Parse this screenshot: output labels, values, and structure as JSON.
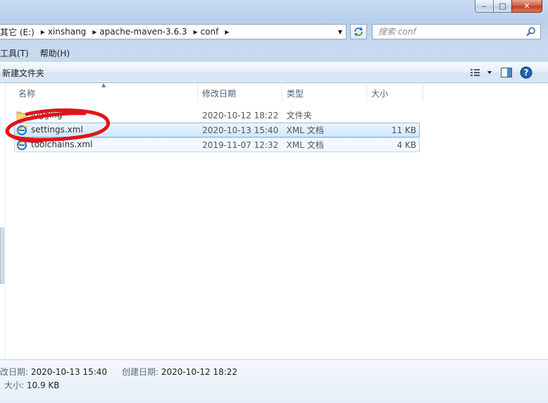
{
  "window": {
    "caption_buttons": {
      "minimize": "–",
      "maximize": "□",
      "close": "✕"
    }
  },
  "address": {
    "crumbs": [
      "其它 (E:)",
      "xinshang",
      "apache-maven-3.6.3",
      "conf"
    ],
    "dropdown_icon": "chevron-down-icon",
    "refresh_icon": "refresh-icon"
  },
  "search": {
    "placeholder": "搜索 conf",
    "icon": "search-icon"
  },
  "menubar": {
    "items": [
      "工具(T)",
      "帮助(H)"
    ]
  },
  "toolbar": {
    "new_folder_label": "新建文件夹",
    "icons": [
      "view-options-icon",
      "preview-pane-icon",
      "help-icon"
    ]
  },
  "columns": {
    "name": "名称",
    "modified": "修改日期",
    "type": "类型",
    "size": "大小"
  },
  "files": [
    {
      "name": "logging",
      "modified": "2020-10-12 18:22",
      "type": "文件夹",
      "size": "",
      "icon": "folder-icon"
    },
    {
      "name": "settings.xml",
      "modified": "2020-10-13 15:40",
      "type": "XML 文档",
      "size": "11 KB",
      "icon": "ie-xml-icon"
    },
    {
      "name": "toolchains.xml",
      "modified": "2019-11-07 12:32",
      "type": "XML 文档",
      "size": "4 KB",
      "icon": "ie-xml-icon"
    }
  ],
  "details": {
    "modified_label": "改日期:",
    "modified_value": "2020-10-13 15:40",
    "created_label": "创建日期:",
    "created_value": "2020-10-12 18:22",
    "size_label": "大小:",
    "size_value": "10.9 KB"
  },
  "colors": {
    "selection_border": "#8fbce8",
    "annotation_red": "#e0141a",
    "folder_yellow": "#e9c45a",
    "ie_blue": "#1f78d1"
  }
}
